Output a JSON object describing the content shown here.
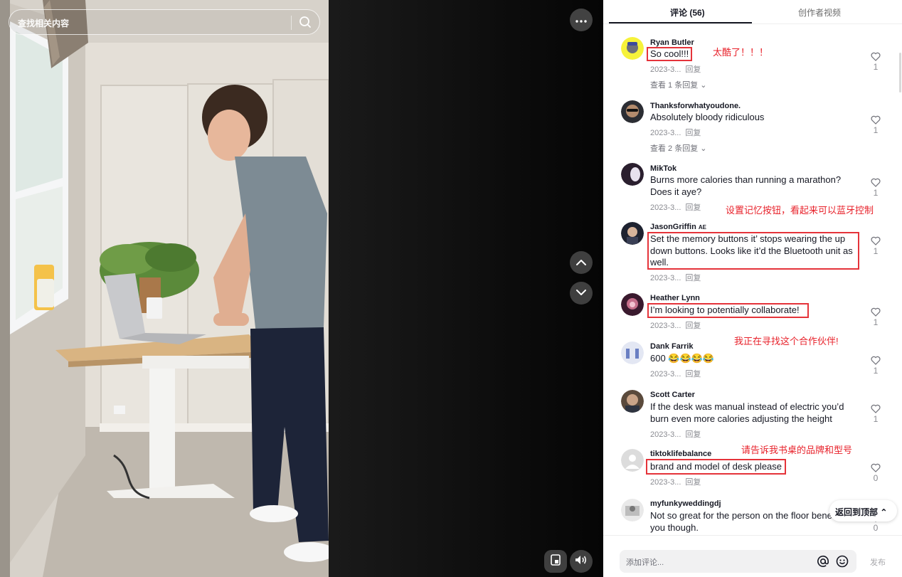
{
  "search": {
    "placeholder": "查找相关内容"
  },
  "tabs": {
    "comments_label": "评论 (56)",
    "creator_label": "创作者视频"
  },
  "colors": {
    "accent": "#161823",
    "highlight": "#e5333a",
    "annotation": "#e8222b"
  },
  "comments": [
    {
      "author": "Ryan Butler",
      "text": "So cool!!!",
      "date": "2023-3...",
      "reply": "回复",
      "likes": "1",
      "view_replies": "查看 1 条回复 ⌄",
      "annotation": "太酷了！！！"
    },
    {
      "author": "Thanksforwhatyoudone.",
      "text": "Absolutely bloody ridiculous",
      "date": "2023-3...",
      "reply": "回复",
      "likes": "1",
      "view_replies": "查看 2 条回复 ⌄"
    },
    {
      "author": "MikTok",
      "text": "Burns more calories than running a marathon? Does it aye?",
      "date": "2023-3...",
      "reply": "回复",
      "likes": "1"
    },
    {
      "author": "JasonGriffin",
      "badge": "AE",
      "text": "Set the memory buttons it’ stops wearing the up down buttons. Looks like it’d the Bluetooth unit as well.",
      "date": "2023-3...",
      "reply": "回复",
      "likes": "1",
      "annotation": "设置记忆按钮，看起来可以蓝牙控制"
    },
    {
      "author": "Heather  Lynn",
      "text": "I’m looking to potentially collaborate!",
      "date": "2023-3...",
      "reply": "回复",
      "likes": "1",
      "annotation": "我正在寻找这个合作伙伴!"
    },
    {
      "author": "Dank Farrik",
      "text": "600 😂😂😂😂",
      "date": "2023-3...",
      "reply": "回复",
      "likes": "1"
    },
    {
      "author": "Scott Carter",
      "text": "If the desk was manual instead of electric you’d burn even more calories adjusting the height",
      "date": "2023-3...",
      "reply": "回复",
      "likes": "1"
    },
    {
      "author": "tiktoklifebalance",
      "text": "brand and model of desk please",
      "date": "2023-3...",
      "reply": "回复",
      "likes": "0",
      "annotation": "请告诉我书桌的品牌和型号"
    },
    {
      "author": "myfunkyweddingdj",
      "text": "Not so great for the person on the floor beneath you though.",
      "likes": "0"
    }
  ],
  "back_to_top": "返回到顶部 ⌃",
  "footer": {
    "placeholder": "添加评论...",
    "post_label": "发布"
  },
  "icons": [
    "search-icon",
    "more-icon",
    "chevron-up-icon",
    "chevron-down-icon",
    "pip-icon",
    "volume-icon",
    "heart-icon",
    "at-icon",
    "emoji-icon"
  ]
}
